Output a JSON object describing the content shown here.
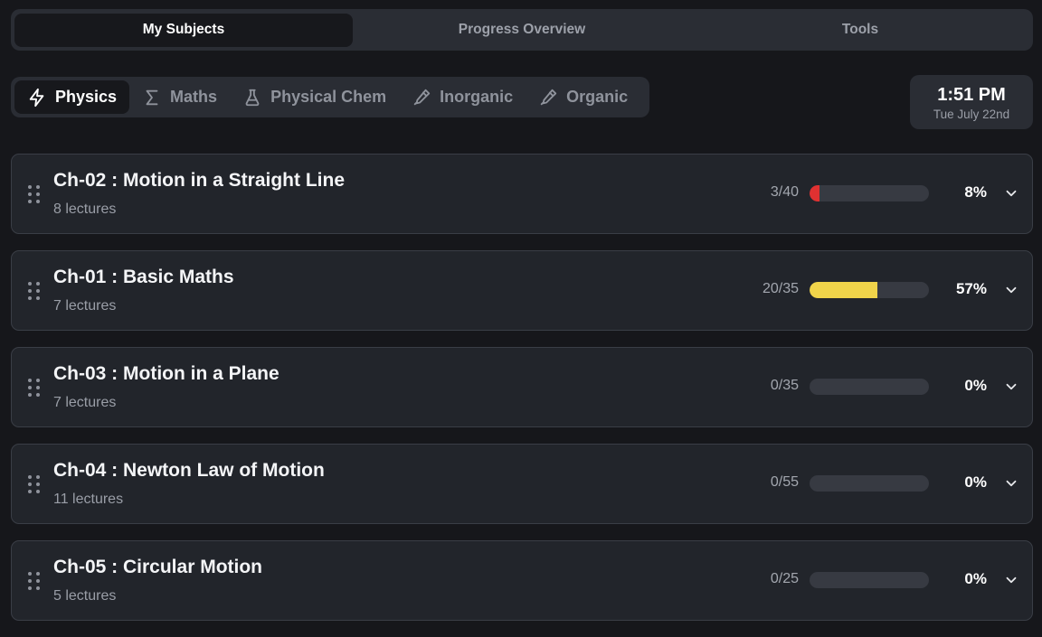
{
  "top_tabs": [
    {
      "label": "My Subjects",
      "active": true
    },
    {
      "label": "Progress Overview",
      "active": false
    },
    {
      "label": "Tools",
      "active": false
    }
  ],
  "subjects": [
    {
      "label": "Physics",
      "icon": "lightning-icon",
      "active": true
    },
    {
      "label": "Maths",
      "icon": "sigma-icon",
      "active": false
    },
    {
      "label": "Physical Chem",
      "icon": "flask-icon",
      "active": false
    },
    {
      "label": "Inorganic",
      "icon": "pipette-icon",
      "active": false
    },
    {
      "label": "Organic",
      "icon": "pipette-icon",
      "active": false
    }
  ],
  "clock": {
    "time": "1:51 PM",
    "date": "Tue July 22nd"
  },
  "colors": {
    "low": "#e03131",
    "mid": "#f0d44a",
    "track": "#373a42"
  },
  "chapters": [
    {
      "title": "Ch-02 : Motion in a Straight Line",
      "lectures": "8 lectures",
      "count": "3/40",
      "percent": "8%",
      "progress": 0.08,
      "color": "#e03131"
    },
    {
      "title": "Ch-01 : Basic Maths",
      "lectures": "7 lectures",
      "count": "20/35",
      "percent": "57%",
      "progress": 0.57,
      "color": "#f0d44a"
    },
    {
      "title": "Ch-03 : Motion in a Plane",
      "lectures": "7 lectures",
      "count": "0/35",
      "percent": "0%",
      "progress": 0,
      "color": "#e03131"
    },
    {
      "title": "Ch-04 : Newton Law of Motion",
      "lectures": "11 lectures",
      "count": "0/55",
      "percent": "0%",
      "progress": 0,
      "color": "#e03131"
    },
    {
      "title": "Ch-05 : Circular Motion",
      "lectures": "5 lectures",
      "count": "0/25",
      "percent": "0%",
      "progress": 0,
      "color": "#e03131"
    }
  ]
}
